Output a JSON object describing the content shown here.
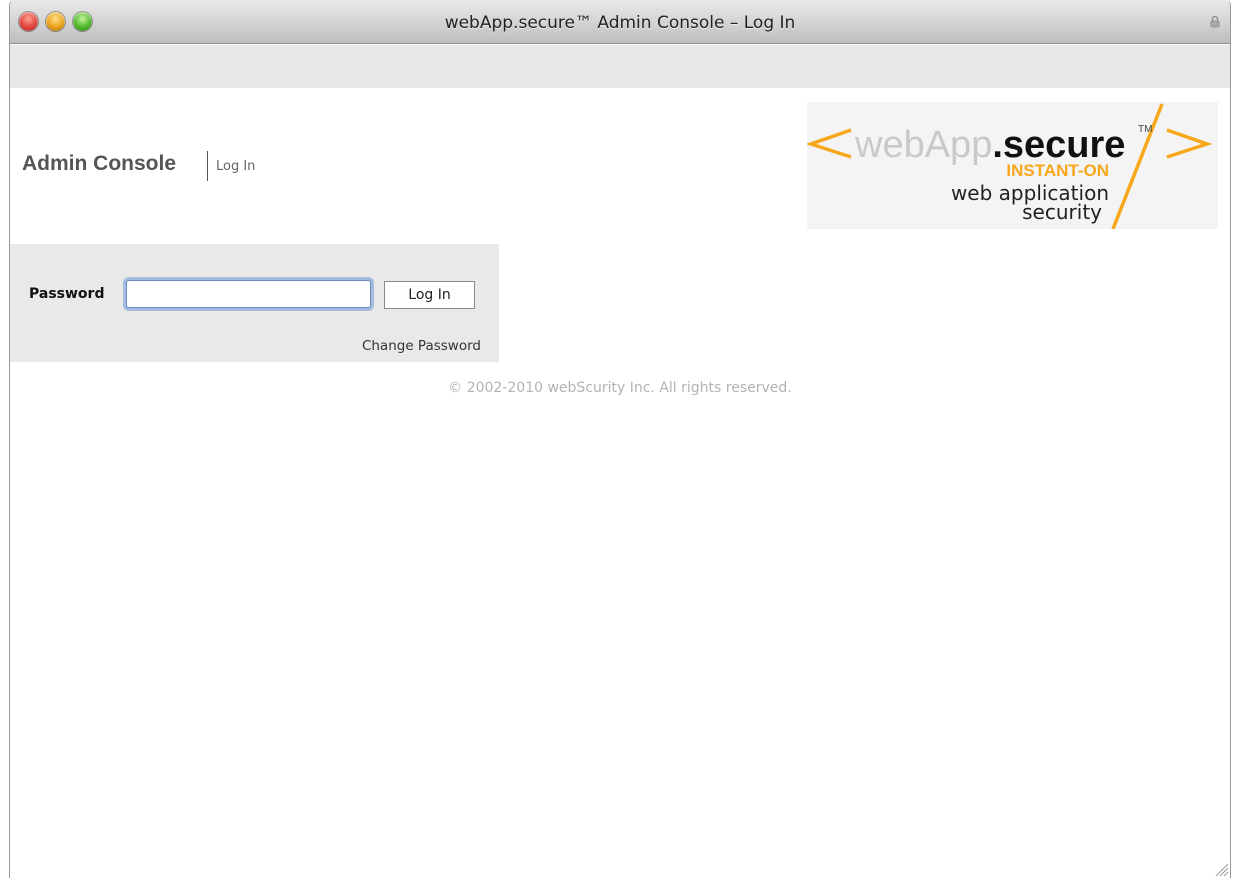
{
  "window": {
    "title": "webApp.secure™ Admin Console – Log In",
    "icons": [
      "close-button",
      "minimize-button",
      "zoom-button",
      "lock-icon",
      "resize-grip"
    ]
  },
  "header": {
    "title": "Admin Console",
    "subtitle": "Log In"
  },
  "logo": {
    "text_light": "webApp",
    "text_bold": ".secure",
    "trademark": "TM",
    "tagline": "INSTANT-ON",
    "line1": "web application",
    "line2": "security",
    "bracket_left": "<",
    "bracket_right": ">",
    "accent_color": "#f7a71b"
  },
  "login": {
    "password_label": "Password",
    "password_value": "",
    "button_label": "Log In",
    "change_password_link": "Change Password"
  },
  "footer": {
    "copyright": "© 2002-2010 webScurity Inc. All rights reserved."
  }
}
